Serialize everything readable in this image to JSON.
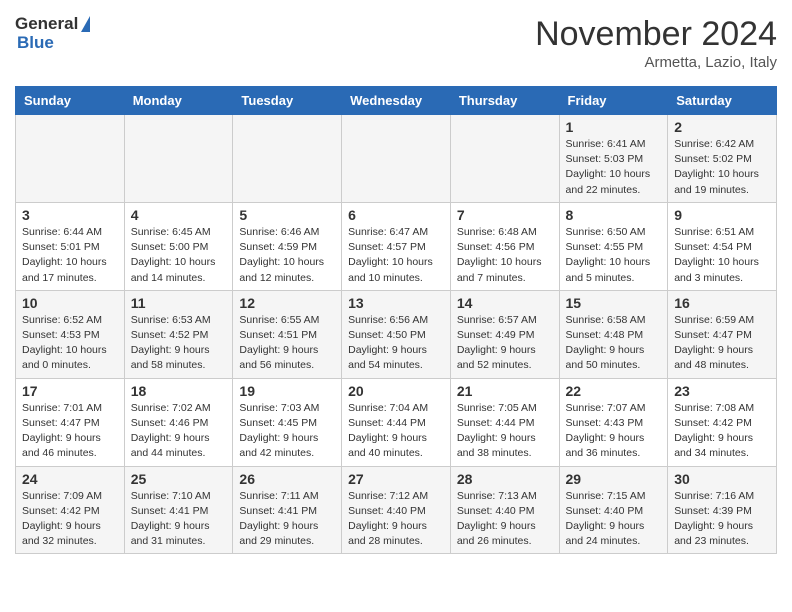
{
  "header": {
    "logo_general": "General",
    "logo_blue": "Blue",
    "month_title": "November 2024",
    "location": "Armetta, Lazio, Italy"
  },
  "days_of_week": [
    "Sunday",
    "Monday",
    "Tuesday",
    "Wednesday",
    "Thursday",
    "Friday",
    "Saturday"
  ],
  "weeks": [
    [
      {
        "day": "",
        "info": ""
      },
      {
        "day": "",
        "info": ""
      },
      {
        "day": "",
        "info": ""
      },
      {
        "day": "",
        "info": ""
      },
      {
        "day": "",
        "info": ""
      },
      {
        "day": "1",
        "info": "Sunrise: 6:41 AM\nSunset: 5:03 PM\nDaylight: 10 hours\nand 22 minutes."
      },
      {
        "day": "2",
        "info": "Sunrise: 6:42 AM\nSunset: 5:02 PM\nDaylight: 10 hours\nand 19 minutes."
      }
    ],
    [
      {
        "day": "3",
        "info": "Sunrise: 6:44 AM\nSunset: 5:01 PM\nDaylight: 10 hours\nand 17 minutes."
      },
      {
        "day": "4",
        "info": "Sunrise: 6:45 AM\nSunset: 5:00 PM\nDaylight: 10 hours\nand 14 minutes."
      },
      {
        "day": "5",
        "info": "Sunrise: 6:46 AM\nSunset: 4:59 PM\nDaylight: 10 hours\nand 12 minutes."
      },
      {
        "day": "6",
        "info": "Sunrise: 6:47 AM\nSunset: 4:57 PM\nDaylight: 10 hours\nand 10 minutes."
      },
      {
        "day": "7",
        "info": "Sunrise: 6:48 AM\nSunset: 4:56 PM\nDaylight: 10 hours\nand 7 minutes."
      },
      {
        "day": "8",
        "info": "Sunrise: 6:50 AM\nSunset: 4:55 PM\nDaylight: 10 hours\nand 5 minutes."
      },
      {
        "day": "9",
        "info": "Sunrise: 6:51 AM\nSunset: 4:54 PM\nDaylight: 10 hours\nand 3 minutes."
      }
    ],
    [
      {
        "day": "10",
        "info": "Sunrise: 6:52 AM\nSunset: 4:53 PM\nDaylight: 10 hours\nand 0 minutes."
      },
      {
        "day": "11",
        "info": "Sunrise: 6:53 AM\nSunset: 4:52 PM\nDaylight: 9 hours\nand 58 minutes."
      },
      {
        "day": "12",
        "info": "Sunrise: 6:55 AM\nSunset: 4:51 PM\nDaylight: 9 hours\nand 56 minutes."
      },
      {
        "day": "13",
        "info": "Sunrise: 6:56 AM\nSunset: 4:50 PM\nDaylight: 9 hours\nand 54 minutes."
      },
      {
        "day": "14",
        "info": "Sunrise: 6:57 AM\nSunset: 4:49 PM\nDaylight: 9 hours\nand 52 minutes."
      },
      {
        "day": "15",
        "info": "Sunrise: 6:58 AM\nSunset: 4:48 PM\nDaylight: 9 hours\nand 50 minutes."
      },
      {
        "day": "16",
        "info": "Sunrise: 6:59 AM\nSunset: 4:47 PM\nDaylight: 9 hours\nand 48 minutes."
      }
    ],
    [
      {
        "day": "17",
        "info": "Sunrise: 7:01 AM\nSunset: 4:47 PM\nDaylight: 9 hours\nand 46 minutes."
      },
      {
        "day": "18",
        "info": "Sunrise: 7:02 AM\nSunset: 4:46 PM\nDaylight: 9 hours\nand 44 minutes."
      },
      {
        "day": "19",
        "info": "Sunrise: 7:03 AM\nSunset: 4:45 PM\nDaylight: 9 hours\nand 42 minutes."
      },
      {
        "day": "20",
        "info": "Sunrise: 7:04 AM\nSunset: 4:44 PM\nDaylight: 9 hours\nand 40 minutes."
      },
      {
        "day": "21",
        "info": "Sunrise: 7:05 AM\nSunset: 4:44 PM\nDaylight: 9 hours\nand 38 minutes."
      },
      {
        "day": "22",
        "info": "Sunrise: 7:07 AM\nSunset: 4:43 PM\nDaylight: 9 hours\nand 36 minutes."
      },
      {
        "day": "23",
        "info": "Sunrise: 7:08 AM\nSunset: 4:42 PM\nDaylight: 9 hours\nand 34 minutes."
      }
    ],
    [
      {
        "day": "24",
        "info": "Sunrise: 7:09 AM\nSunset: 4:42 PM\nDaylight: 9 hours\nand 32 minutes."
      },
      {
        "day": "25",
        "info": "Sunrise: 7:10 AM\nSunset: 4:41 PM\nDaylight: 9 hours\nand 31 minutes."
      },
      {
        "day": "26",
        "info": "Sunrise: 7:11 AM\nSunset: 4:41 PM\nDaylight: 9 hours\nand 29 minutes."
      },
      {
        "day": "27",
        "info": "Sunrise: 7:12 AM\nSunset: 4:40 PM\nDaylight: 9 hours\nand 28 minutes."
      },
      {
        "day": "28",
        "info": "Sunrise: 7:13 AM\nSunset: 4:40 PM\nDaylight: 9 hours\nand 26 minutes."
      },
      {
        "day": "29",
        "info": "Sunrise: 7:15 AM\nSunset: 4:40 PM\nDaylight: 9 hours\nand 24 minutes."
      },
      {
        "day": "30",
        "info": "Sunrise: 7:16 AM\nSunset: 4:39 PM\nDaylight: 9 hours\nand 23 minutes."
      }
    ]
  ]
}
